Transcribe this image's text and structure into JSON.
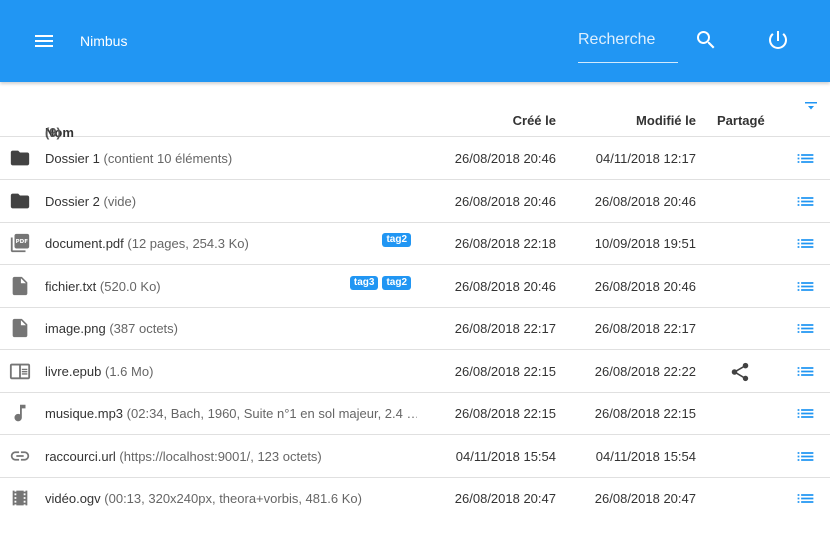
{
  "app": {
    "title": "Nimbus"
  },
  "search": {
    "placeholder": "Recherche"
  },
  "colors": {
    "primary": "#2196f3",
    "tag": "#2196f3",
    "icon": "#616161"
  },
  "table": {
    "headers": {
      "name": "Nom",
      "count": "(9)",
      "created": "Créé le",
      "modified": "Modifié le",
      "shared": "Partagé"
    },
    "rows": [
      {
        "icon": "folder-icon",
        "name": "Dossier 1",
        "meta": "(contient 10 éléments)",
        "tags": [],
        "created": "26/08/2018 20:46",
        "modified": "04/11/2018 12:17",
        "shared": false
      },
      {
        "icon": "folder-icon",
        "name": "Dossier 2",
        "meta": "(vide)",
        "tags": [],
        "created": "26/08/2018 20:46",
        "modified": "26/08/2018 20:46",
        "shared": false
      },
      {
        "icon": "pdf-icon",
        "name": "document.pdf",
        "meta": "(12 pages, 254.3 Ko)",
        "tags": [
          "tag2"
        ],
        "created": "26/08/2018 22:18",
        "modified": "10/09/2018 19:51",
        "shared": false
      },
      {
        "icon": "file-icon",
        "name": "fichier.txt",
        "meta": "(520.0 Ko)",
        "tags": [
          "tag3",
          "tag2"
        ],
        "created": "26/08/2018 20:46",
        "modified": "26/08/2018 20:46",
        "shared": false
      },
      {
        "icon": "file-icon",
        "name": "image.png",
        "meta": "(387 octets)",
        "tags": [],
        "created": "26/08/2018 22:17",
        "modified": "26/08/2018 22:17",
        "shared": false
      },
      {
        "icon": "book-icon",
        "name": "livre.epub",
        "meta": "(1.6 Mo)",
        "tags": [],
        "created": "26/08/2018 22:15",
        "modified": "26/08/2018 22:22",
        "shared": true
      },
      {
        "icon": "music-note-icon",
        "name": "musique.mp3",
        "meta": "(02:34, Bach, 1960, Suite n°1 en sol majeur, 2.4 …",
        "tags": [],
        "created": "26/08/2018 22:15",
        "modified": "26/08/2018 22:15",
        "shared": false
      },
      {
        "icon": "link-icon",
        "name": "raccourci.url",
        "meta": "(https://localhost:9001/, 123 octets)",
        "tags": [],
        "created": "04/11/2018 15:54",
        "modified": "04/11/2018 15:54",
        "shared": false
      },
      {
        "icon": "film-icon",
        "name": "vidéo.ogv",
        "meta": "(00:13, 320x240px, theora+vorbis, 481.6 Ko)",
        "tags": [],
        "created": "26/08/2018 20:47",
        "modified": "26/08/2018 20:47",
        "shared": false
      }
    ]
  }
}
